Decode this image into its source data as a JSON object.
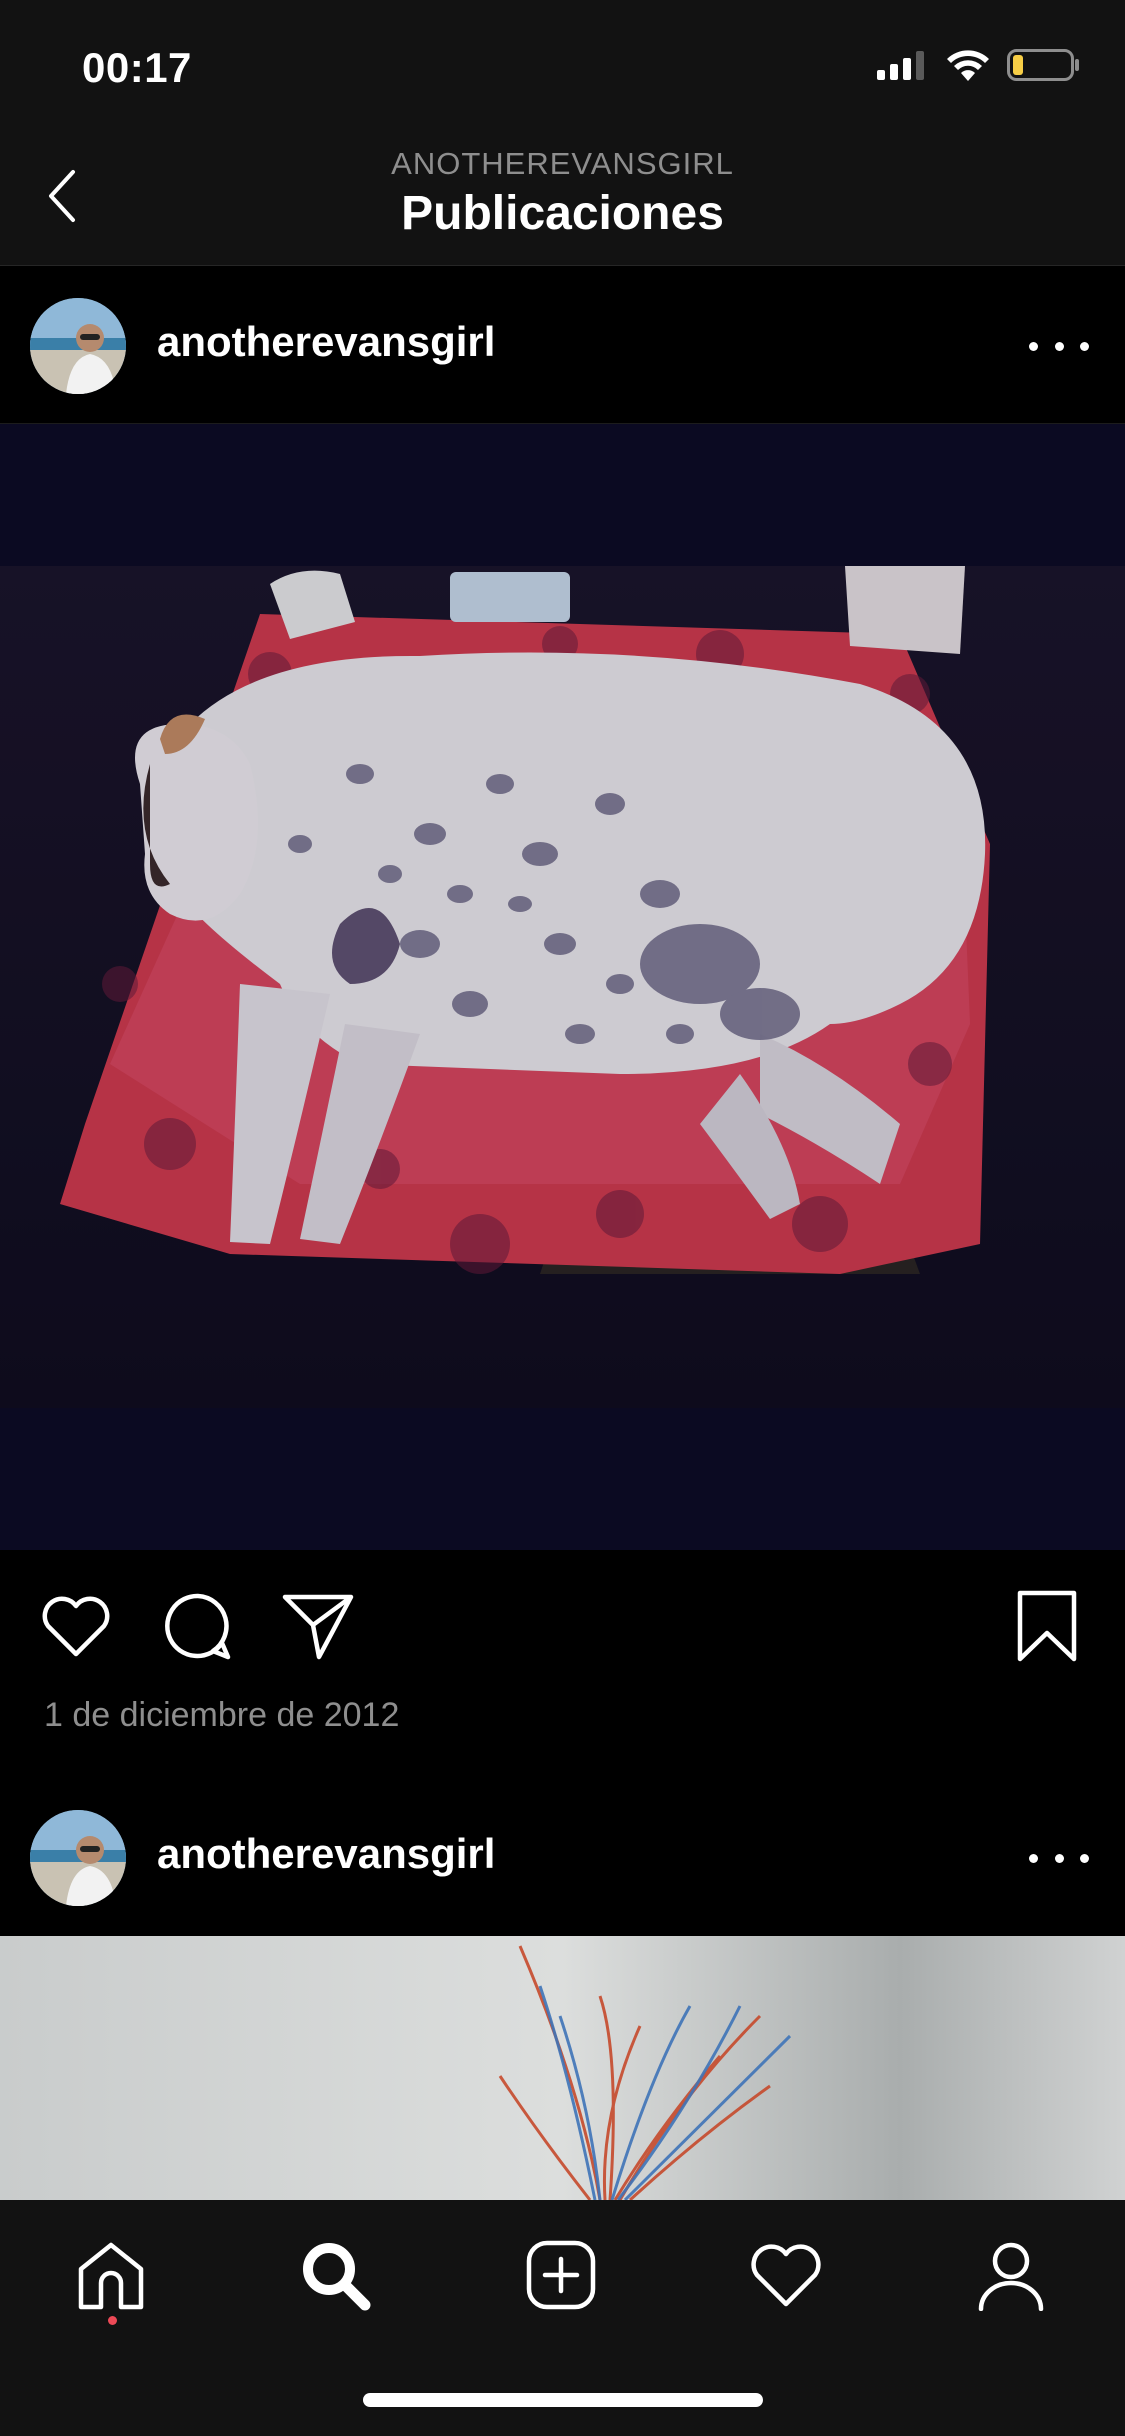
{
  "status_bar": {
    "time": "00:17",
    "icons": [
      "signal-icon",
      "wifi-icon",
      "battery-icon"
    ]
  },
  "header": {
    "subtitle": "ANOTHEREVANSGIRL",
    "title": "Publicaciones",
    "back_icon": "chevron-left-icon"
  },
  "posts": [
    {
      "username": "anotherevansgirl",
      "more_icon": "more-horizontal-icon",
      "image": "photo of a white spotted dog sleeping on a red floral cushion",
      "actions": [
        "heart-icon",
        "comment-icon",
        "share-icon",
        "bookmark-icon"
      ],
      "date": "1 de diciembre de 2012"
    },
    {
      "username": "anotherevansgirl",
      "more_icon": "more-horizontal-icon",
      "image": "photo of red and blue feathers against a white wall"
    }
  ],
  "tab_bar": {
    "items": [
      "home-icon",
      "search-icon",
      "add-post-icon",
      "activity-heart-icon",
      "profile-icon"
    ],
    "active": "search-icon"
  },
  "colors": {
    "background": "#000000",
    "bars": "#121212",
    "secondary_text": "#8e8e8e",
    "notification_dot": "#ed4956",
    "battery_low": "#f7ce46"
  }
}
